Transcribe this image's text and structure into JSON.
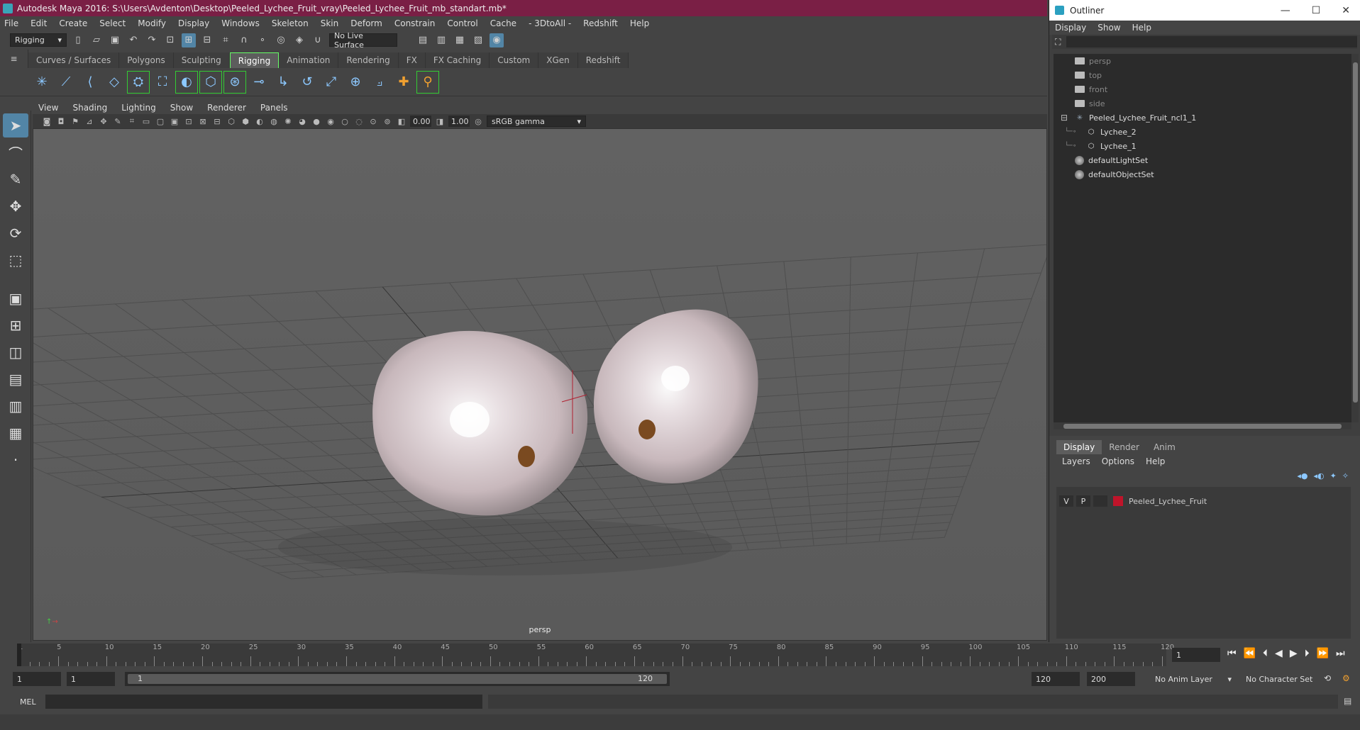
{
  "window": {
    "title": "Autodesk Maya 2016: S:\\Users\\Avdenton\\Desktop\\Peeled_Lychee_Fruit_vray\\Peeled_Lychee_Fruit_mb_standart.mb*"
  },
  "menubar": [
    "File",
    "Edit",
    "Create",
    "Select",
    "Modify",
    "Display",
    "Windows",
    "Skeleton",
    "Skin",
    "Deform",
    "Constrain",
    "Control",
    "Cache",
    "- 3DtoAll -",
    "Redshift",
    "Help"
  ],
  "status": {
    "menuset": "Rigging",
    "live_surface": "No Live Surface"
  },
  "shelf_tabs": [
    "Curves / Surfaces",
    "Polygons",
    "Sculpting",
    "Rigging",
    "Animation",
    "Rendering",
    "FX",
    "FX Caching",
    "Custom",
    "XGen",
    "Redshift"
  ],
  "shelf_selected": "Rigging",
  "viewport": {
    "menu": [
      "View",
      "Shading",
      "Lighting",
      "Show",
      "Renderer",
      "Panels"
    ],
    "exposure": "0.00",
    "gamma": "1.00",
    "color_space": "sRGB gamma",
    "camera": "persp"
  },
  "outliner": {
    "title": "Outliner",
    "menu": [
      "Display",
      "Show",
      "Help"
    ],
    "items": [
      {
        "label": "persp",
        "type": "camera",
        "indent": 0,
        "dim": true
      },
      {
        "label": "top",
        "type": "camera",
        "indent": 0,
        "dim": true
      },
      {
        "label": "front",
        "type": "camera",
        "indent": 0,
        "dim": true
      },
      {
        "label": "side",
        "type": "camera",
        "indent": 0,
        "dim": true
      },
      {
        "label": "Peeled_Lychee_Fruit_ncl1_1",
        "type": "group",
        "indent": 0,
        "dim": false
      },
      {
        "label": "Lychee_2",
        "type": "mesh",
        "indent": 1,
        "dim": false
      },
      {
        "label": "Lychee_1",
        "type": "mesh",
        "indent": 1,
        "dim": false
      },
      {
        "label": "defaultLightSet",
        "type": "set",
        "indent": 0,
        "dim": false
      },
      {
        "label": "defaultObjectSet",
        "type": "set",
        "indent": 0,
        "dim": false
      }
    ]
  },
  "layer_editor": {
    "tabs": [
      "Display",
      "Render",
      "Anim"
    ],
    "selected_tab": "Display",
    "menu": [
      "Layers",
      "Options",
      "Help"
    ],
    "layers": [
      {
        "v": "V",
        "p": "P",
        "name": "Peeled_Lychee_Fruit",
        "color": "#c0142a"
      }
    ]
  },
  "timeline": {
    "ticks": [
      "1",
      "5",
      "10",
      "15",
      "20",
      "25",
      "30",
      "35",
      "40",
      "45",
      "50",
      "55",
      "60",
      "65",
      "70",
      "75",
      "80",
      "85",
      "90",
      "95",
      "100",
      "105",
      "110",
      "115",
      "120"
    ],
    "current_frame": "1"
  },
  "range": {
    "start": "1",
    "playback_start": "1",
    "slider_start": "1",
    "slider_end": "120",
    "playback_end": "120",
    "end": "200",
    "anim_layer": "No Anim Layer",
    "character_set": "No Character Set"
  },
  "command": {
    "lang": "MEL"
  },
  "colors": {
    "title_bar": "#7a1f45",
    "selection_blue": "#5285a6",
    "layer_color": "#c0142a"
  }
}
